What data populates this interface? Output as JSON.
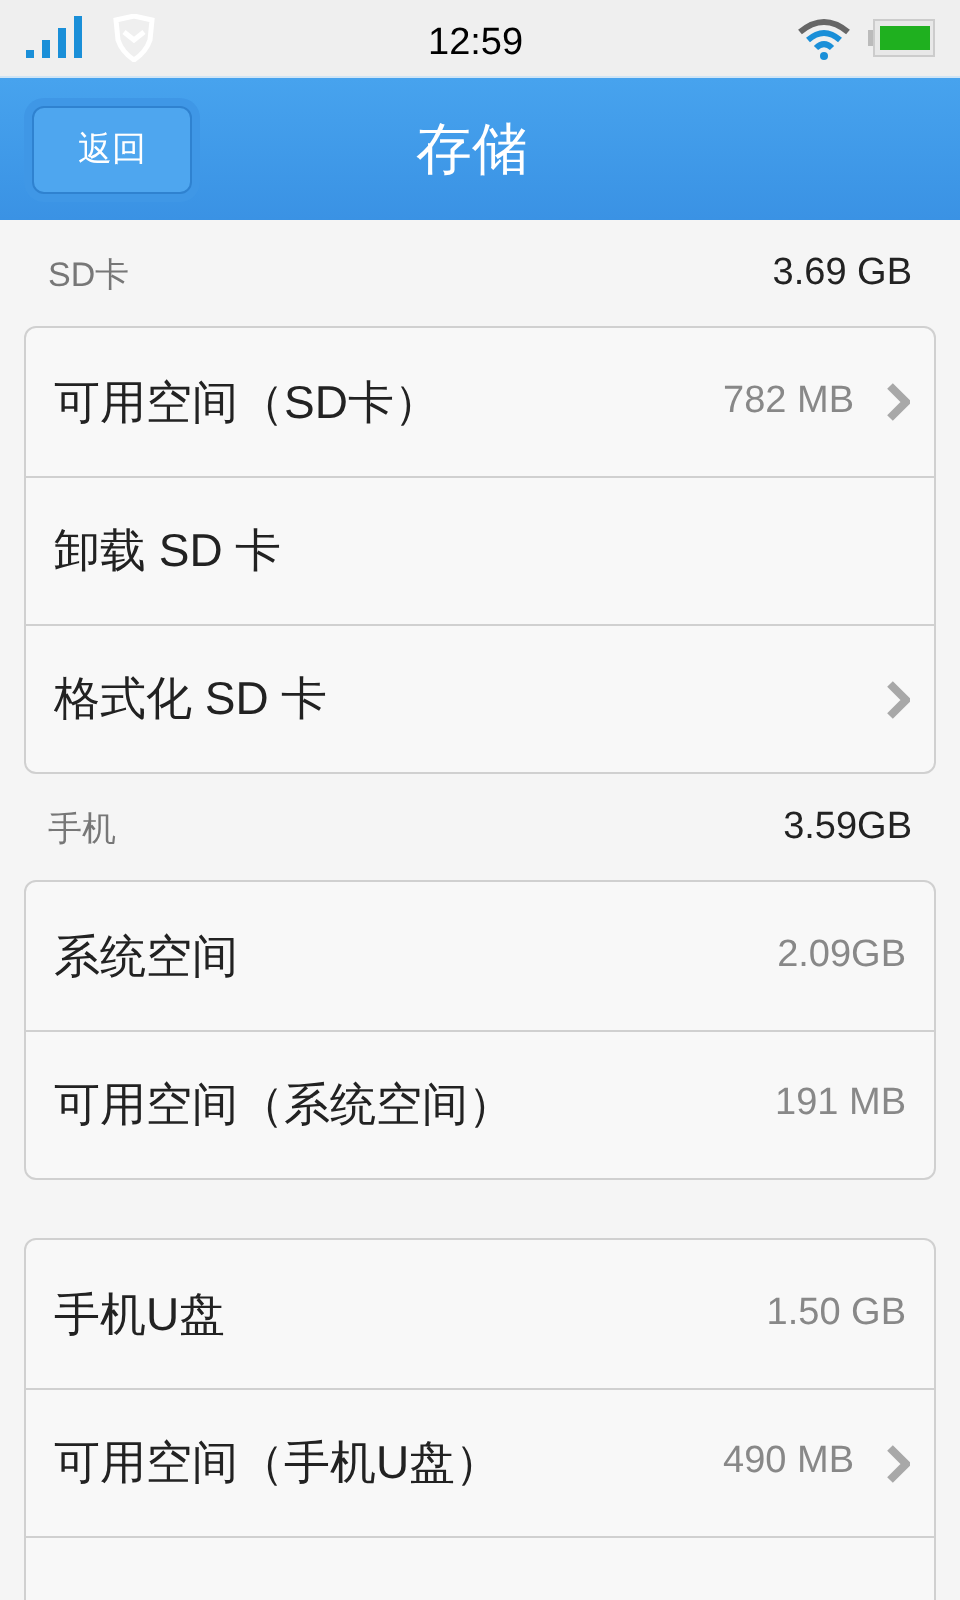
{
  "status_bar": {
    "time": "12:59"
  },
  "header": {
    "back_button": "返回",
    "title": "存储"
  },
  "sections": [
    {
      "label": "SD卡",
      "total": "3.69 GB",
      "rows": [
        {
          "kind": "item",
          "label": "可用空间（SD卡）",
          "value": "782 MB",
          "chevron": true
        },
        {
          "kind": "item",
          "label": "卸载 SD 卡",
          "chevron": false
        },
        {
          "kind": "item",
          "label": "格式化 SD 卡",
          "chevron": true
        }
      ]
    },
    {
      "label": "手机",
      "total": "3.59GB",
      "rows": [
        {
          "kind": "item",
          "label": "系统空间",
          "value": "2.09GB",
          "chevron": false
        },
        {
          "kind": "item",
          "label": "可用空间（系统空间）",
          "value": "191 MB",
          "chevron": false
        }
      ]
    },
    {
      "rows": [
        {
          "kind": "item",
          "label": "手机U盘",
          "value": "1.50 GB",
          "chevron": false
        },
        {
          "kind": "item",
          "label": "可用空间（手机U盘）",
          "value": "490 MB",
          "chevron": true
        },
        {
          "kind": "blank"
        }
      ]
    }
  ]
}
